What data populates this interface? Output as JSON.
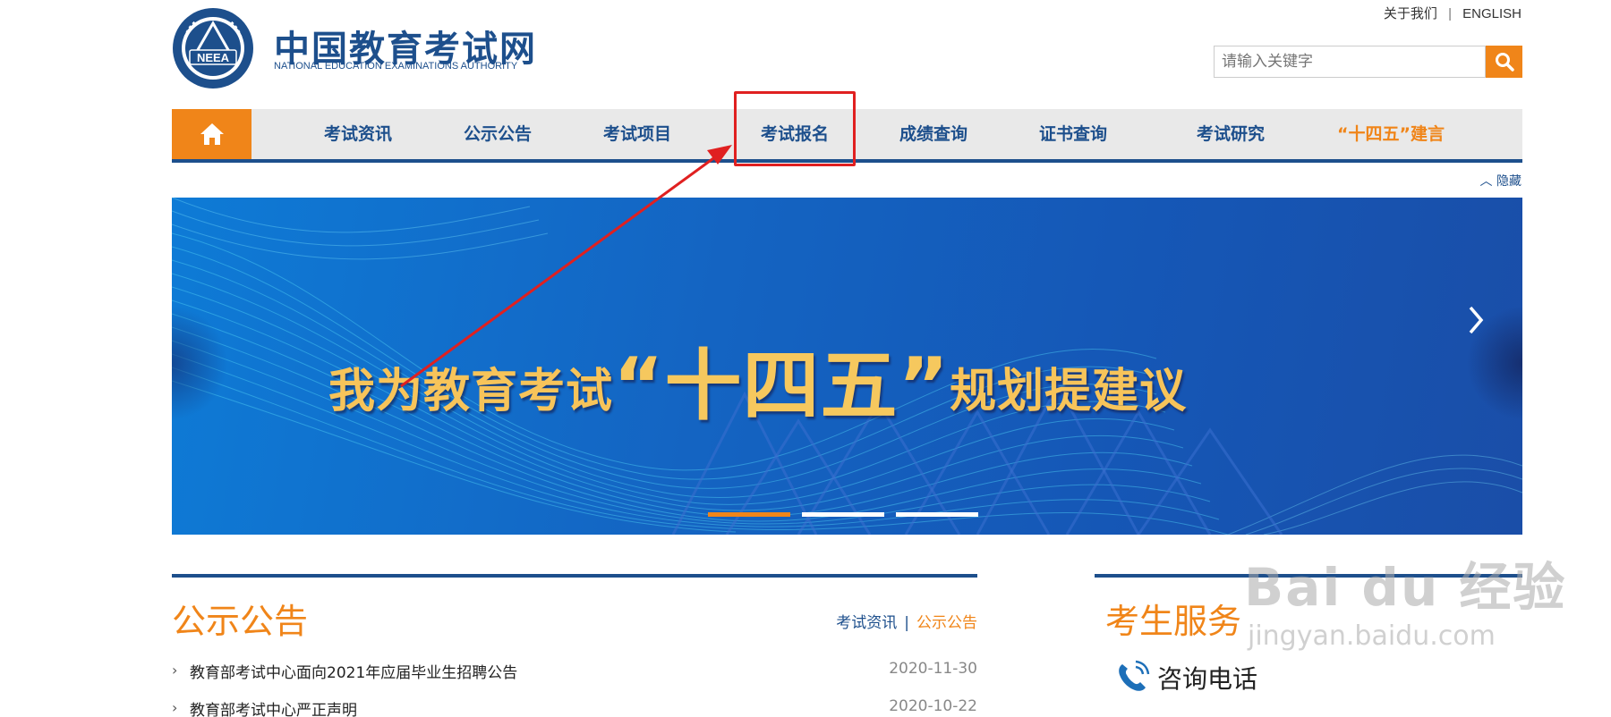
{
  "header": {
    "logo_text": "NEEA",
    "site_title": "中国教育考试网",
    "site_subtitle": "NATIONAL EDUCATION EXAMINATIONS AUTHORITY",
    "top_links": {
      "about": "关于我们",
      "separator": "|",
      "english": "ENGLISH"
    },
    "search": {
      "placeholder": "请输入关键字"
    }
  },
  "nav": {
    "items": [
      {
        "label": "考试资讯"
      },
      {
        "label": "公示公告"
      },
      {
        "label": "考试项目"
      },
      {
        "label": "考试报名"
      },
      {
        "label": "成绩查询"
      },
      {
        "label": "证书查询"
      },
      {
        "label": "考试研究"
      },
      {
        "label": "“十四五”建言"
      }
    ],
    "hide_label": "隐藏"
  },
  "banner": {
    "text_before": "我为教育考试",
    "text_big": "“十四五”",
    "text_after": "规划提建议",
    "active_slide": 1,
    "slide_count": 3
  },
  "notices": {
    "title": "公示公告",
    "tabs": [
      {
        "label": "考试资讯"
      },
      {
        "label": "公示公告"
      }
    ],
    "tab_separator": "|",
    "items": [
      {
        "text": "教育部考试中心面向2021年应届毕业生招聘公告",
        "date": "2020-11-30"
      },
      {
        "text": "教育部考试中心严正声明",
        "date": "2020-10-22"
      }
    ]
  },
  "services": {
    "title": "考生服务",
    "phone_label": "咨询电话"
  },
  "watermark": {
    "main": "Bai du 经验",
    "sub": "jingyan.baidu.com"
  },
  "colors": {
    "brand_blue": "#1d4f8c",
    "accent_orange": "#f08519",
    "annotation_red": "#e02020"
  }
}
